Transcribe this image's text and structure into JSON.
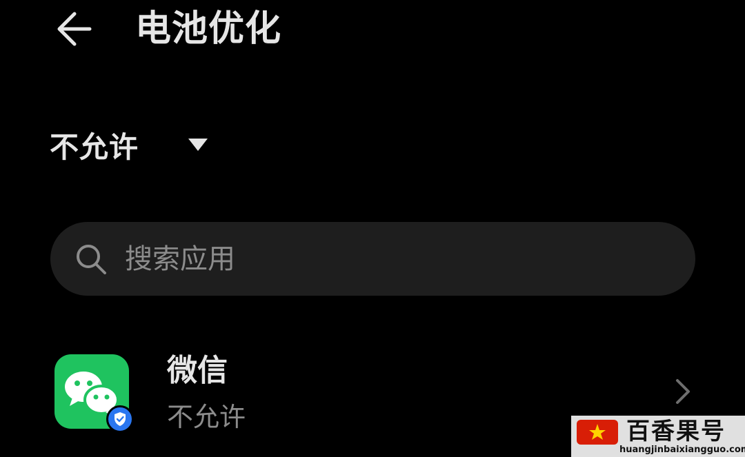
{
  "header": {
    "title": "电池优化",
    "back_icon": "arrow-left-icon"
  },
  "filter": {
    "selected": "不允许",
    "caret_icon": "caret-down-icon"
  },
  "search": {
    "placeholder": "搜索应用",
    "icon": "search-icon"
  },
  "apps": [
    {
      "name": "微信",
      "status": "不允许",
      "icon": "wechat-icon",
      "badge_icon": "verified-shield-icon",
      "chevron_icon": "chevron-right-icon"
    }
  ],
  "watermark": {
    "brand": "百香果号",
    "url": "huangjinbaixiangguo.com"
  },
  "colors": {
    "background": "#000000",
    "text_primary": "#e6e6e6",
    "text_secondary": "#8c8c8c",
    "search_bg": "#1e1e1e",
    "wechat_green": "#1fc35f",
    "badge_blue": "#2a76f0"
  }
}
